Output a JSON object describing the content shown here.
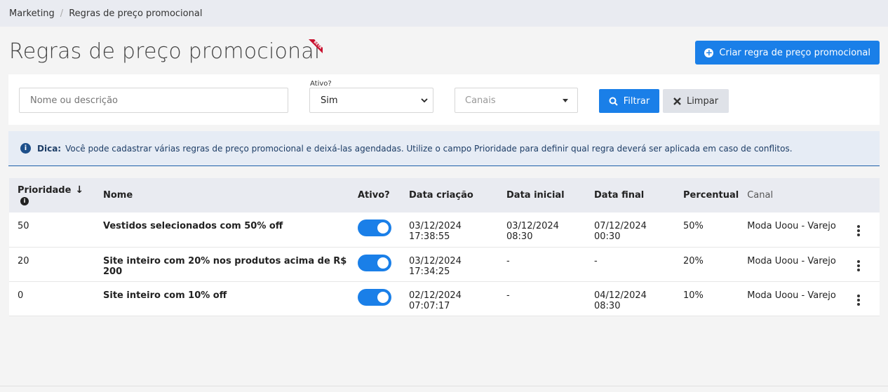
{
  "breadcrumb": {
    "root": "Marketing",
    "separator": "/",
    "current": "Regras de preço promocional"
  },
  "page": {
    "title": "Regras de preço promocional",
    "beta": "BETA",
    "create_label": "Criar regra de preço promocional"
  },
  "filters": {
    "name_placeholder": "Nome ou descrição",
    "ativo_label": "Ativo?",
    "ativo_value": "Sim",
    "canais_placeholder": "Canais",
    "filter_label": "Filtrar",
    "clear_label": "Limpar"
  },
  "tip": {
    "label": "Dica:",
    "text": "Você pode cadastrar várias regras de preço promocional e deixá-las agendadas. Utilize o campo Prioridade para definir qual regra deverá ser aplicada em caso de conflitos."
  },
  "table": {
    "headers": {
      "prioridade": "Prioridade",
      "nome": "Nome",
      "ativo": "Ativo?",
      "data_criacao": "Data criação",
      "data_inicial": "Data inicial",
      "data_final": "Data final",
      "percentual": "Percentual",
      "canal": "Canal"
    },
    "rows": [
      {
        "prioridade": "50",
        "nome": "Vestidos selecionados com 50% off",
        "ativo": true,
        "data_criacao": "03/12/2024 17:38:55",
        "data_inicial": "03/12/2024 08:30",
        "data_final": "07/12/2024 00:30",
        "percentual": "50%",
        "canal": "Moda Uoou - Varejo"
      },
      {
        "prioridade": "20",
        "nome": "Site inteiro com 20% nos produtos acima de R$ 200",
        "ativo": true,
        "data_criacao": "03/12/2024 17:34:25",
        "data_inicial": "-",
        "data_final": "-",
        "percentual": "20%",
        "canal": "Moda Uoou - Varejo"
      },
      {
        "prioridade": "0",
        "nome": "Site inteiro com 10% off",
        "ativo": true,
        "data_criacao": "02/12/2024 07:07:17",
        "data_inicial": "-",
        "data_final": "04/12/2024 08:30",
        "percentual": "10%",
        "canal": "Moda Uoou - Varejo"
      }
    ]
  },
  "colors": {
    "primary": "#1a7fe8",
    "breadcrumb_bg": "#e9ebf1",
    "tip_bg": "#e6ecf5",
    "beta_ribbon": "#c8102e"
  },
  "icons": {
    "create": "plus-circle-icon",
    "filter": "search-icon",
    "clear": "x-icon",
    "tip": "info-icon",
    "sort": "arrow-down-icon",
    "row_menu": "kebab-icon"
  }
}
